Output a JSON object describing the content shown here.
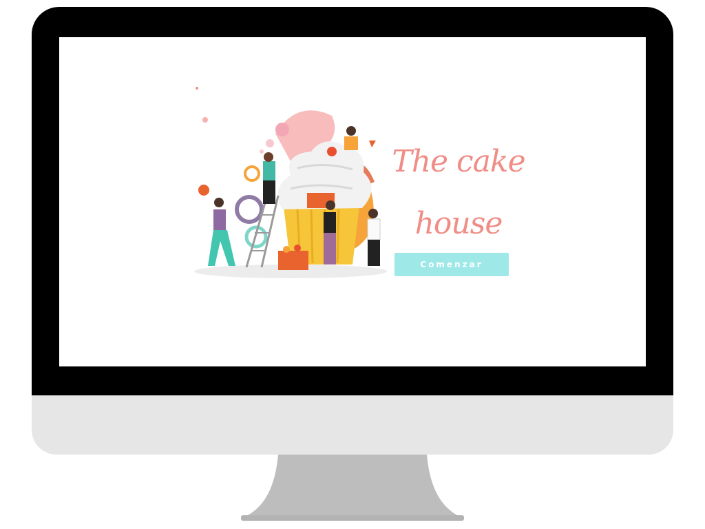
{
  "hero": {
    "title_line1": "The cake",
    "title_line2": "house",
    "illustration": "bakers-decorating-giant-cupcake"
  },
  "cta": {
    "label": "Comenzar"
  },
  "colors": {
    "title": "#f08d86",
    "button": "#9ee8e8",
    "bezel": "#000000",
    "chin": "#e6e6e6",
    "stand": "#bdbdbd"
  }
}
